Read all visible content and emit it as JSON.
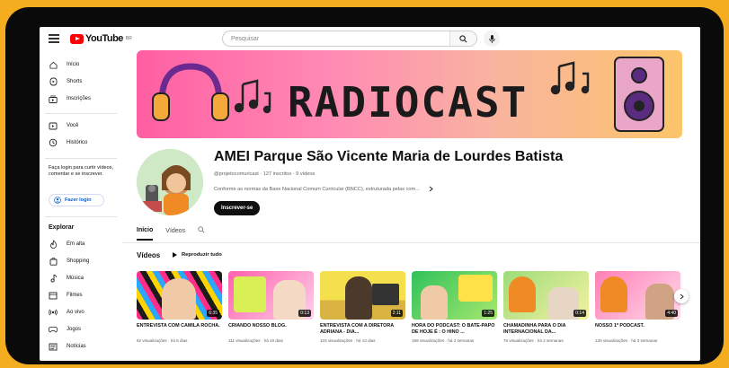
{
  "app": {
    "logo_text": "YouTube",
    "logo_region": "BR"
  },
  "search": {
    "placeholder": "Pesquisar"
  },
  "sidebar": {
    "items": [
      {
        "label": "Início",
        "icon": "home-icon"
      },
      {
        "label": "Shorts",
        "icon": "shorts-icon"
      },
      {
        "label": "Inscrições",
        "icon": "subscriptions-icon"
      },
      {
        "label": "Você",
        "icon": "you-icon"
      },
      {
        "label": "Histórico",
        "icon": "history-icon"
      }
    ],
    "login_prompt": "Faça login para curtir vídeos, comentar e se inscrever.",
    "login_button": "Fazer login",
    "explore_heading": "Explorar",
    "explore_items": [
      {
        "label": "Em alta",
        "icon": "trending-icon"
      },
      {
        "label": "Shopping",
        "icon": "shopping-icon"
      },
      {
        "label": "Música",
        "icon": "music-icon"
      },
      {
        "label": "Filmes",
        "icon": "movies-icon"
      },
      {
        "label": "Ao vivo",
        "icon": "live-icon"
      },
      {
        "label": "Jogos",
        "icon": "gaming-icon"
      },
      {
        "label": "Notícias",
        "icon": "news-icon"
      }
    ]
  },
  "banner": {
    "text": "RADIOCAST"
  },
  "channel": {
    "name": "AMEI Parque São Vicente Maria de Lourdes Batista",
    "meta": "@projetocomuricast · 127 inscritos · 9 vídeos",
    "description": "Conforme as normas da Base Nacional Comum Curricular (BNCC), estruturada pelas com...",
    "subscribe_label": "Inscrever-se"
  },
  "tabs": [
    {
      "label": "Início",
      "active": true
    },
    {
      "label": "Vídeos",
      "active": false
    }
  ],
  "videos_section": {
    "title": "Vídeos",
    "play_all": "Reproduzir tudo",
    "items": [
      {
        "title": "ENTREVISTA COM CAMILA ROCHA.",
        "meta": "62 visualizações · há 5 dias",
        "duration": "6:35"
      },
      {
        "title": "CRIANDO NOSSO BLOG.",
        "meta": "111 visualizações · há 10 dias",
        "duration": "0:13"
      },
      {
        "title": "ENTREVISTA COM A DIRETORA ADRIANA - DIA...",
        "meta": "103 visualizações · há 13 dias",
        "duration": "2:11"
      },
      {
        "title": "HORA DO PODCAST: O BATE-PAPO DE HOJE É : O HINO ...",
        "meta": "159 visualizações · há 2 semanas",
        "duration": "1:25"
      },
      {
        "title": "CHAMADINHA PARA O DIA INTERNACIONAL DA...",
        "meta": "75 visualizações · há 2 semanas",
        "duration": "0:14"
      },
      {
        "title": "NOSSO 1º PODCAST.",
        "meta": "130 visualizações · há 3 semanas",
        "duration": "4:40"
      }
    ]
  },
  "colors": {
    "frame_orange": "#f3ad1e",
    "youtube_red": "#ff0000",
    "subscribe_black": "#0f0f0f"
  }
}
